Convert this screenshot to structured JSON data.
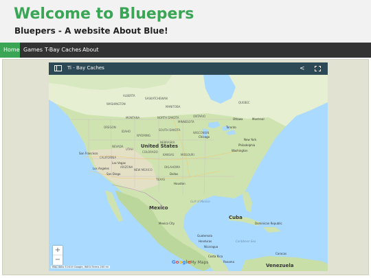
{
  "header": {
    "title": "Welcome to Bluepers",
    "subtitle": "Bluepers - A website About Blue!"
  },
  "nav": {
    "items": [
      {
        "label": "Home",
        "active": true
      },
      {
        "label": "Games",
        "active": false
      },
      {
        "label": "T-Bay Caches",
        "active": false
      },
      {
        "label": "About",
        "active": false
      }
    ]
  },
  "map": {
    "title": "Ti - Bay Caches",
    "zoom_in": "+",
    "zoom_out": "−",
    "logo": "Google",
    "logo_suffix": "My Maps",
    "attribution": "Map data ©2019 Google, INEGI    Terms    200 mi",
    "labels": {
      "united_states": "United States",
      "mexico": "Mexico",
      "cuba": "Cuba",
      "venezuela": "Venezuela",
      "guatemala": "Guatemala",
      "honduras": "Honduras",
      "nicaragua": "Nicaragua",
      "costa_rica": "Costa Rica",
      "panama": "Panama",
      "dominican_republic": "Dominican Republic",
      "caracas": "Caracas",
      "mexico_city": "Mexico City",
      "gulf_of_mexico": "Gulf of Mexico",
      "caribbean_sea": "Caribbean Sea",
      "ottawa": "Ottawa",
      "montreal": "Montreal",
      "toronto": "Toronto",
      "chicago": "Chicago",
      "new_york": "New York",
      "philadelphia": "Philadelphia",
      "washington": "Washington",
      "san_francisco": "San Francisco",
      "los_angeles": "Los Angeles",
      "las_vegas": "Las Vegas",
      "san_diego": "San Diego",
      "dallas": "Dallas",
      "houston": "Houston",
      "washington_state": "WASHINGTON",
      "montana": "MONTANA",
      "north_dakota": "NORTH DAKOTA",
      "minnesota": "MINNESOTA",
      "wisconsin": "WISCONSIN",
      "oregon": "OREGON",
      "idaho": "IDAHO",
      "wyoming": "WYOMING",
      "south_dakota": "SOUTH DAKOTA",
      "nebraska": "NEBRASKA",
      "nevada": "NEVADA",
      "utah": "UTAH",
      "colorado": "COLORADO",
      "kansas": "KANSAS",
      "missouri": "MISSOURI",
      "california": "CALIFORNIA",
      "arizona": "ARIZONA",
      "new_mexico": "NEW MEXICO",
      "oklahoma": "OKLAHOMA",
      "texas": "TEXAS",
      "manitoba": "MANITOBA",
      "ontario": "ONTARIO",
      "quebec": "QUEBEC",
      "saskatchewan": "SASKATCHEWAN",
      "alberta": "ALBERTA"
    }
  },
  "colors": {
    "brand_green": "#3aa655",
    "nav_bg": "#333333",
    "map_header": "#2d4956",
    "water": "#aadaff"
  }
}
